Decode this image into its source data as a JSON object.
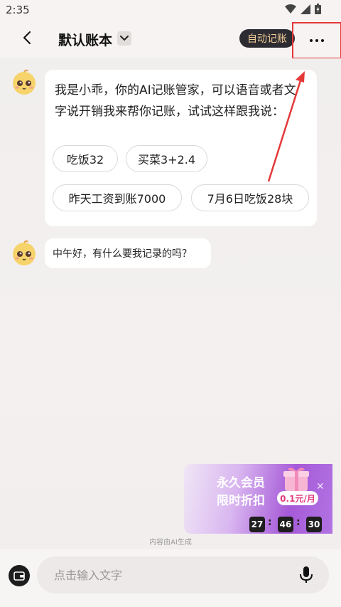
{
  "status": {
    "time": "2:35"
  },
  "header": {
    "title": "默认账本",
    "auto_label": "自动记账"
  },
  "messages": [
    {
      "text": "我是小乖，你的AI记账管家，可以语音或者文字说开销我来帮你记账，试试这样跟我说：",
      "suggestions": [
        "吃饭32",
        "买菜3+2.4",
        "昨天工资到账7000",
        "7月6日吃饭28块"
      ]
    },
    {
      "text": "中午好，有什么要我记录的吗？"
    }
  ],
  "promo": {
    "line1": "永久会员",
    "line2": "限时折扣",
    "price": "0.1元/月",
    "countdown": [
      "27",
      "46",
      "30"
    ]
  },
  "footer": {
    "ai_note": "内容由AI生成",
    "input_placeholder": "点击输入文字"
  },
  "colors": {
    "accent_red": "#e53838",
    "auto_bg": "#2c2b31",
    "auto_text": "#f4cf9a"
  },
  "icons": [
    "back-icon",
    "chevron-down-icon",
    "more-icon",
    "wallet-icon",
    "microphone-icon",
    "avatar-icon"
  ]
}
